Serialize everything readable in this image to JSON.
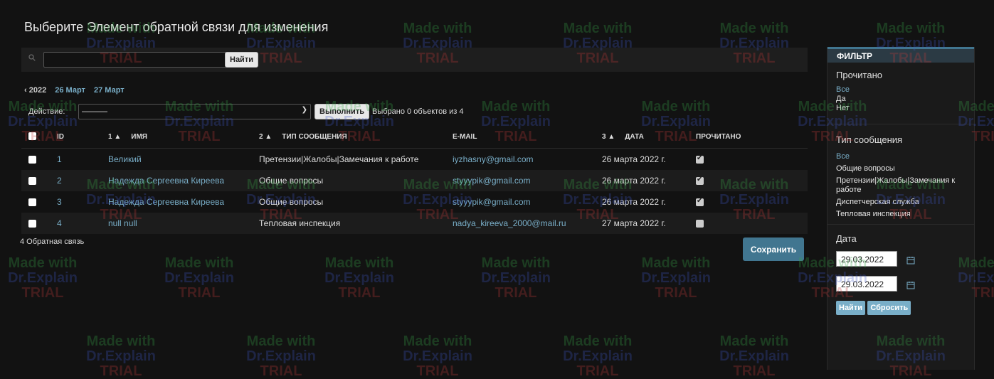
{
  "page_title": "Выберите Элемент обратной связи для изменения",
  "search": {
    "value": "",
    "button_label": "Найти"
  },
  "date_hierarchy": {
    "previous": "‹ 2022",
    "items": [
      "26 Март",
      "27 Март"
    ]
  },
  "actions": {
    "label": "Действие:",
    "selected": "———",
    "go_label": "Выполнить",
    "counter": "Выбрано 0 объектов из 4"
  },
  "table": {
    "headers": {
      "id": "ID",
      "name_sort": "1",
      "name": "ИМЯ",
      "type_sort": "2",
      "type": "ТИП СООБЩЕНИЯ",
      "email": "E-MAIL",
      "date_sort": "3",
      "date": "ДАТА",
      "read": "ПРОЧИТАНО"
    },
    "rows": [
      {
        "id": "1",
        "name": "Великий",
        "type": "Претензии|Жалобы|Замечания к работе",
        "email": "iyzhasny@gmail.com",
        "date": "26 марта 2022 г.",
        "read": true
      },
      {
        "id": "2",
        "name": "Надежда Сергеевна Киреева",
        "type": "Общие вопросы",
        "email": "styyypik@gmail.com",
        "date": "26 марта 2022 г.",
        "read": true
      },
      {
        "id": "3",
        "name": "Надежда Сергеевна Киреева",
        "type": "Общие вопросы",
        "email": "styyypik@gmail.com",
        "date": "26 марта 2022 г.",
        "read": true
      },
      {
        "id": "4",
        "name": "null null",
        "type": "Тепловая инспекция",
        "email": "nadya_kireeva_2000@mail.ru",
        "date": "27 марта 2022 г.",
        "read": false
      }
    ]
  },
  "paginator": "4 Обратная связь",
  "save_label": "Сохранить",
  "filter": {
    "title": "ФИЛЬТР",
    "read": {
      "title": "Прочитано",
      "options": [
        "Все",
        "Да",
        "Нет"
      ]
    },
    "type": {
      "title": "Тип сообщения",
      "options": [
        "Все",
        "Общие вопросы",
        "Претензии|Жалобы|Замечания к работе",
        "Диспетчерская служба",
        "Тепловая инспекция"
      ]
    },
    "date": {
      "title": "Дата",
      "from": "29.03.2022",
      "to": "29.03.2022",
      "search_label": "Найти",
      "reset_label": "Сбросить"
    }
  },
  "watermark": {
    "line1": "Made with",
    "line2": "Dr.Explain",
    "line3": "TRIAL"
  },
  "colors": {
    "background": "#121212",
    "link": "#79aec8",
    "primary_button": "#417690",
    "header_bar": "#2b3a44"
  },
  "icons": [
    "search-icon",
    "chevron-down-icon",
    "checkbox-icon",
    "sort-asc-icon",
    "calendar-icon"
  ]
}
